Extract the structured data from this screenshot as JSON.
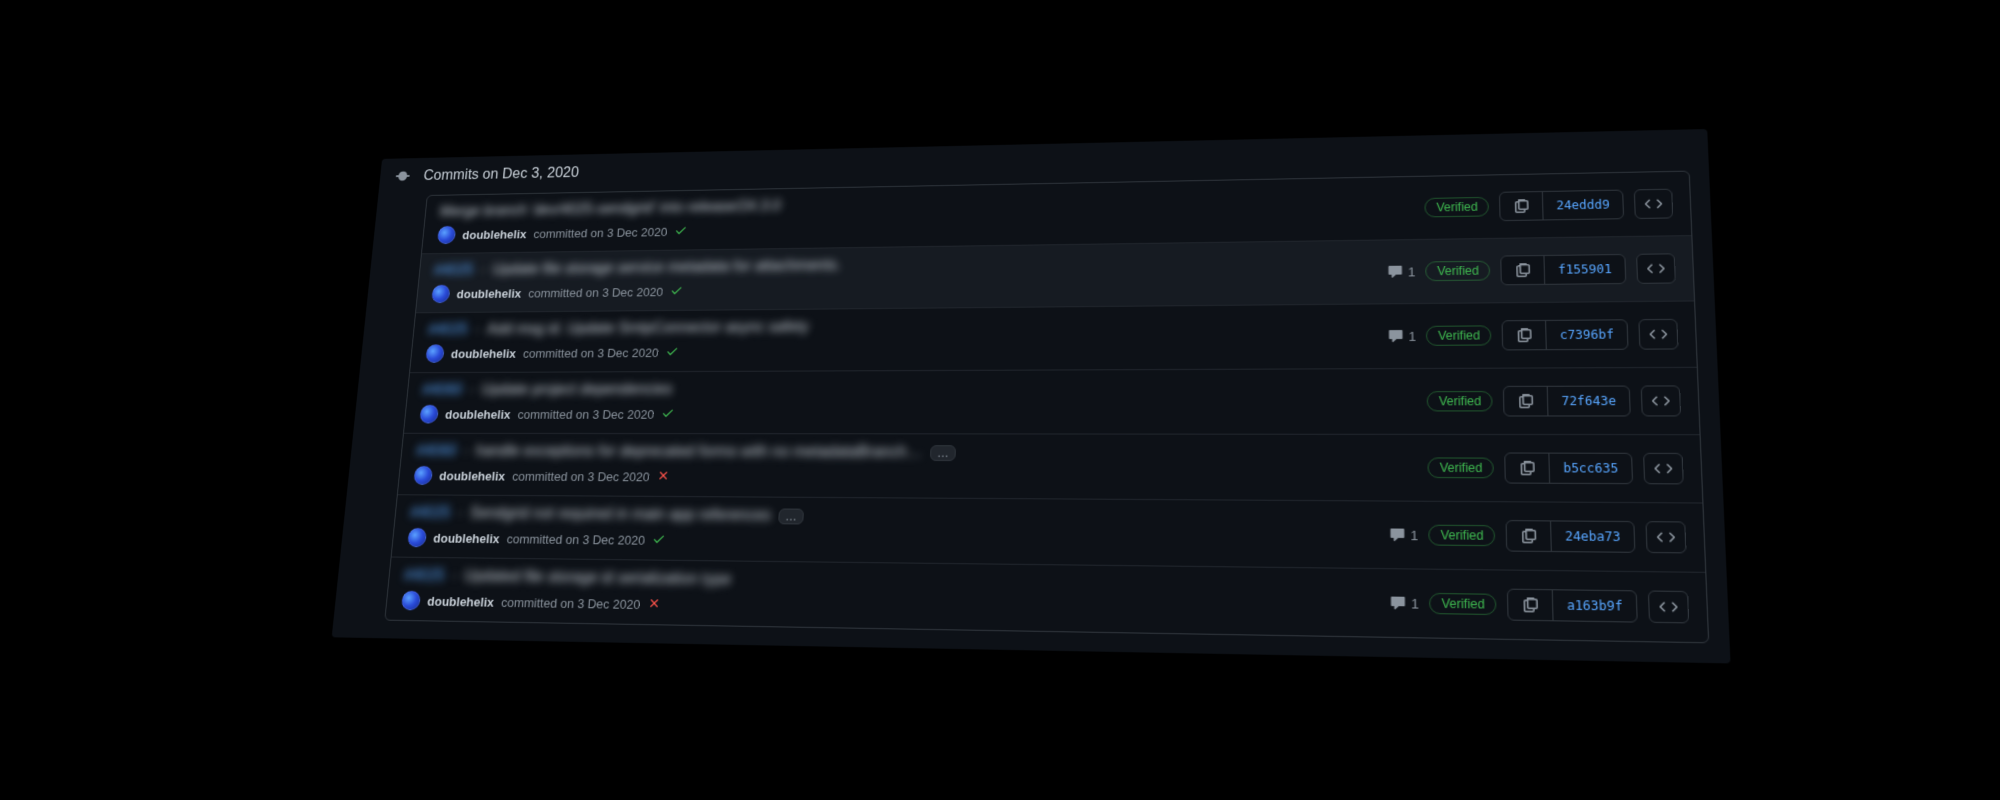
{
  "timeline": {
    "heading": "Commits on Dec 3, 2020"
  },
  "labels": {
    "verified": "Verified",
    "ellipsis": "…",
    "committed_prefix": "committed on"
  },
  "author": {
    "name": "doublehelix"
  },
  "commits": [
    {
      "issue": "",
      "title": "Merge branch 'dev/4025-sendgrid' into release/24.3.0",
      "date": "3 Dec 2020",
      "status": "success",
      "comments": null,
      "verified": true,
      "sha": "24eddd9",
      "ellipsis": false,
      "highlight": false
    },
    {
      "issue": "#4025",
      "title": "Update file storage service metadata for attachments.",
      "date": "3 Dec 2020",
      "status": "success",
      "comments": 1,
      "verified": true,
      "sha": "f155901",
      "ellipsis": false,
      "highlight": true
    },
    {
      "issue": "#4025",
      "title": "Add msg id. Update SmtpConnector async safety",
      "date": "3 Dec 2020",
      "status": "success",
      "comments": 1,
      "verified": true,
      "sha": "c7396bf",
      "ellipsis": false,
      "highlight": false
    },
    {
      "issue": "#4060",
      "title": "Update project dependencies",
      "date": "3 Dec 2020",
      "status": "success",
      "comments": null,
      "verified": true,
      "sha": "72f643e",
      "ellipsis": false,
      "highlight": false
    },
    {
      "issue": "#4060",
      "title": "handle exceptions for deprecated forms with no metadataBranch…",
      "date": "3 Dec 2020",
      "status": "failure",
      "comments": null,
      "verified": true,
      "sha": "b5cc635",
      "ellipsis": true,
      "highlight": false
    },
    {
      "issue": "#4025",
      "title": "Sendgrid not required in main app references",
      "date": "3 Dec 2020",
      "status": "success",
      "comments": 1,
      "verified": true,
      "sha": "24eba73",
      "ellipsis": true,
      "highlight": false
    },
    {
      "issue": "#4025",
      "title": "Updated file storage id serialization type",
      "date": "3 Dec 2020",
      "status": "failure",
      "comments": 1,
      "verified": true,
      "sha": "a163b9f",
      "ellipsis": false,
      "highlight": false
    }
  ]
}
